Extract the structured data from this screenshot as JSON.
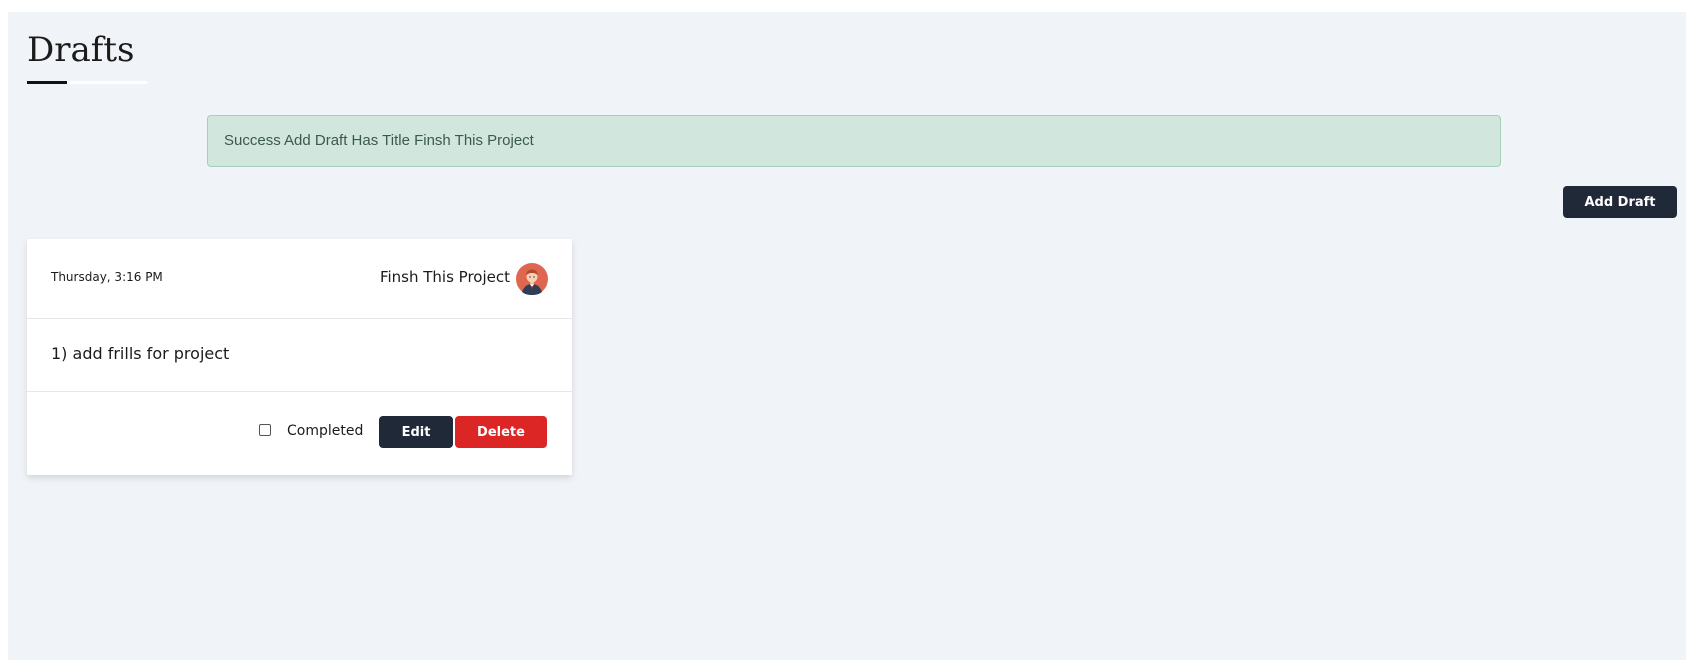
{
  "page": {
    "title": "Drafts"
  },
  "alert": {
    "message": "Success Add Draft Has Title Finsh This Project"
  },
  "toolbar": {
    "add_draft_label": "Add Draft"
  },
  "drafts": [
    {
      "date": "Thursday, 3:16 PM",
      "title": "Finsh This Project",
      "content": "1) add frills for project",
      "completed_label": "Completed",
      "completed": false,
      "edit_label": "Edit",
      "delete_label": "Delete",
      "avatar_icon": "user-avatar-icon"
    }
  ],
  "colors": {
    "background": "#f0f3f7",
    "alert_bg": "#d1e7dd",
    "primary_button": "#1f2937",
    "danger_button": "#dc2626",
    "avatar_bg": "#e0674f"
  }
}
